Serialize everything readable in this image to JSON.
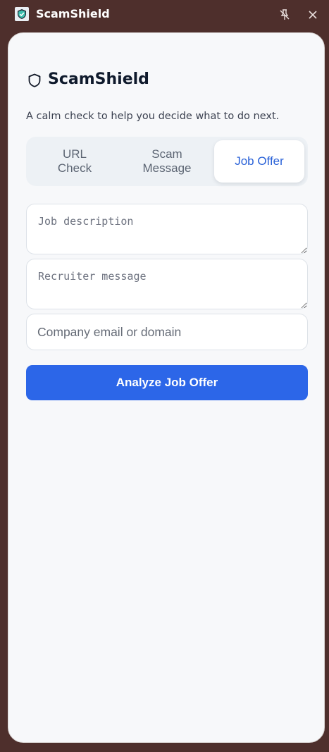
{
  "window": {
    "title": "ScamShield",
    "app_icon": "shield-check-icon",
    "controls": [
      {
        "name": "pin",
        "icon": "unpin-icon"
      },
      {
        "name": "close",
        "icon": "close-icon"
      }
    ]
  },
  "header": {
    "brand_icon": "shield-icon",
    "brand_title": "ScamShield",
    "subtitle": "A calm check to help you decide what to do next."
  },
  "tabs": [
    {
      "label": "URL Check",
      "active": false
    },
    {
      "label": "Scam Message",
      "active": false
    },
    {
      "label": "Job Offer",
      "active": true
    }
  ],
  "form": {
    "job_description": {
      "value": "",
      "placeholder": "Job description"
    },
    "recruiter_message": {
      "value": "",
      "placeholder": "Recruiter message"
    },
    "company_domain": {
      "value": "",
      "placeholder": "Company email or domain"
    },
    "submit_label": "Analyze Job Offer"
  },
  "colors": {
    "window_frame": "#4e2f2c",
    "panel_bg": "#f7f8fa",
    "accent": "#2c66e8",
    "active_tab_text": "#2a62d8",
    "brand_text": "#0f1a2c"
  }
}
